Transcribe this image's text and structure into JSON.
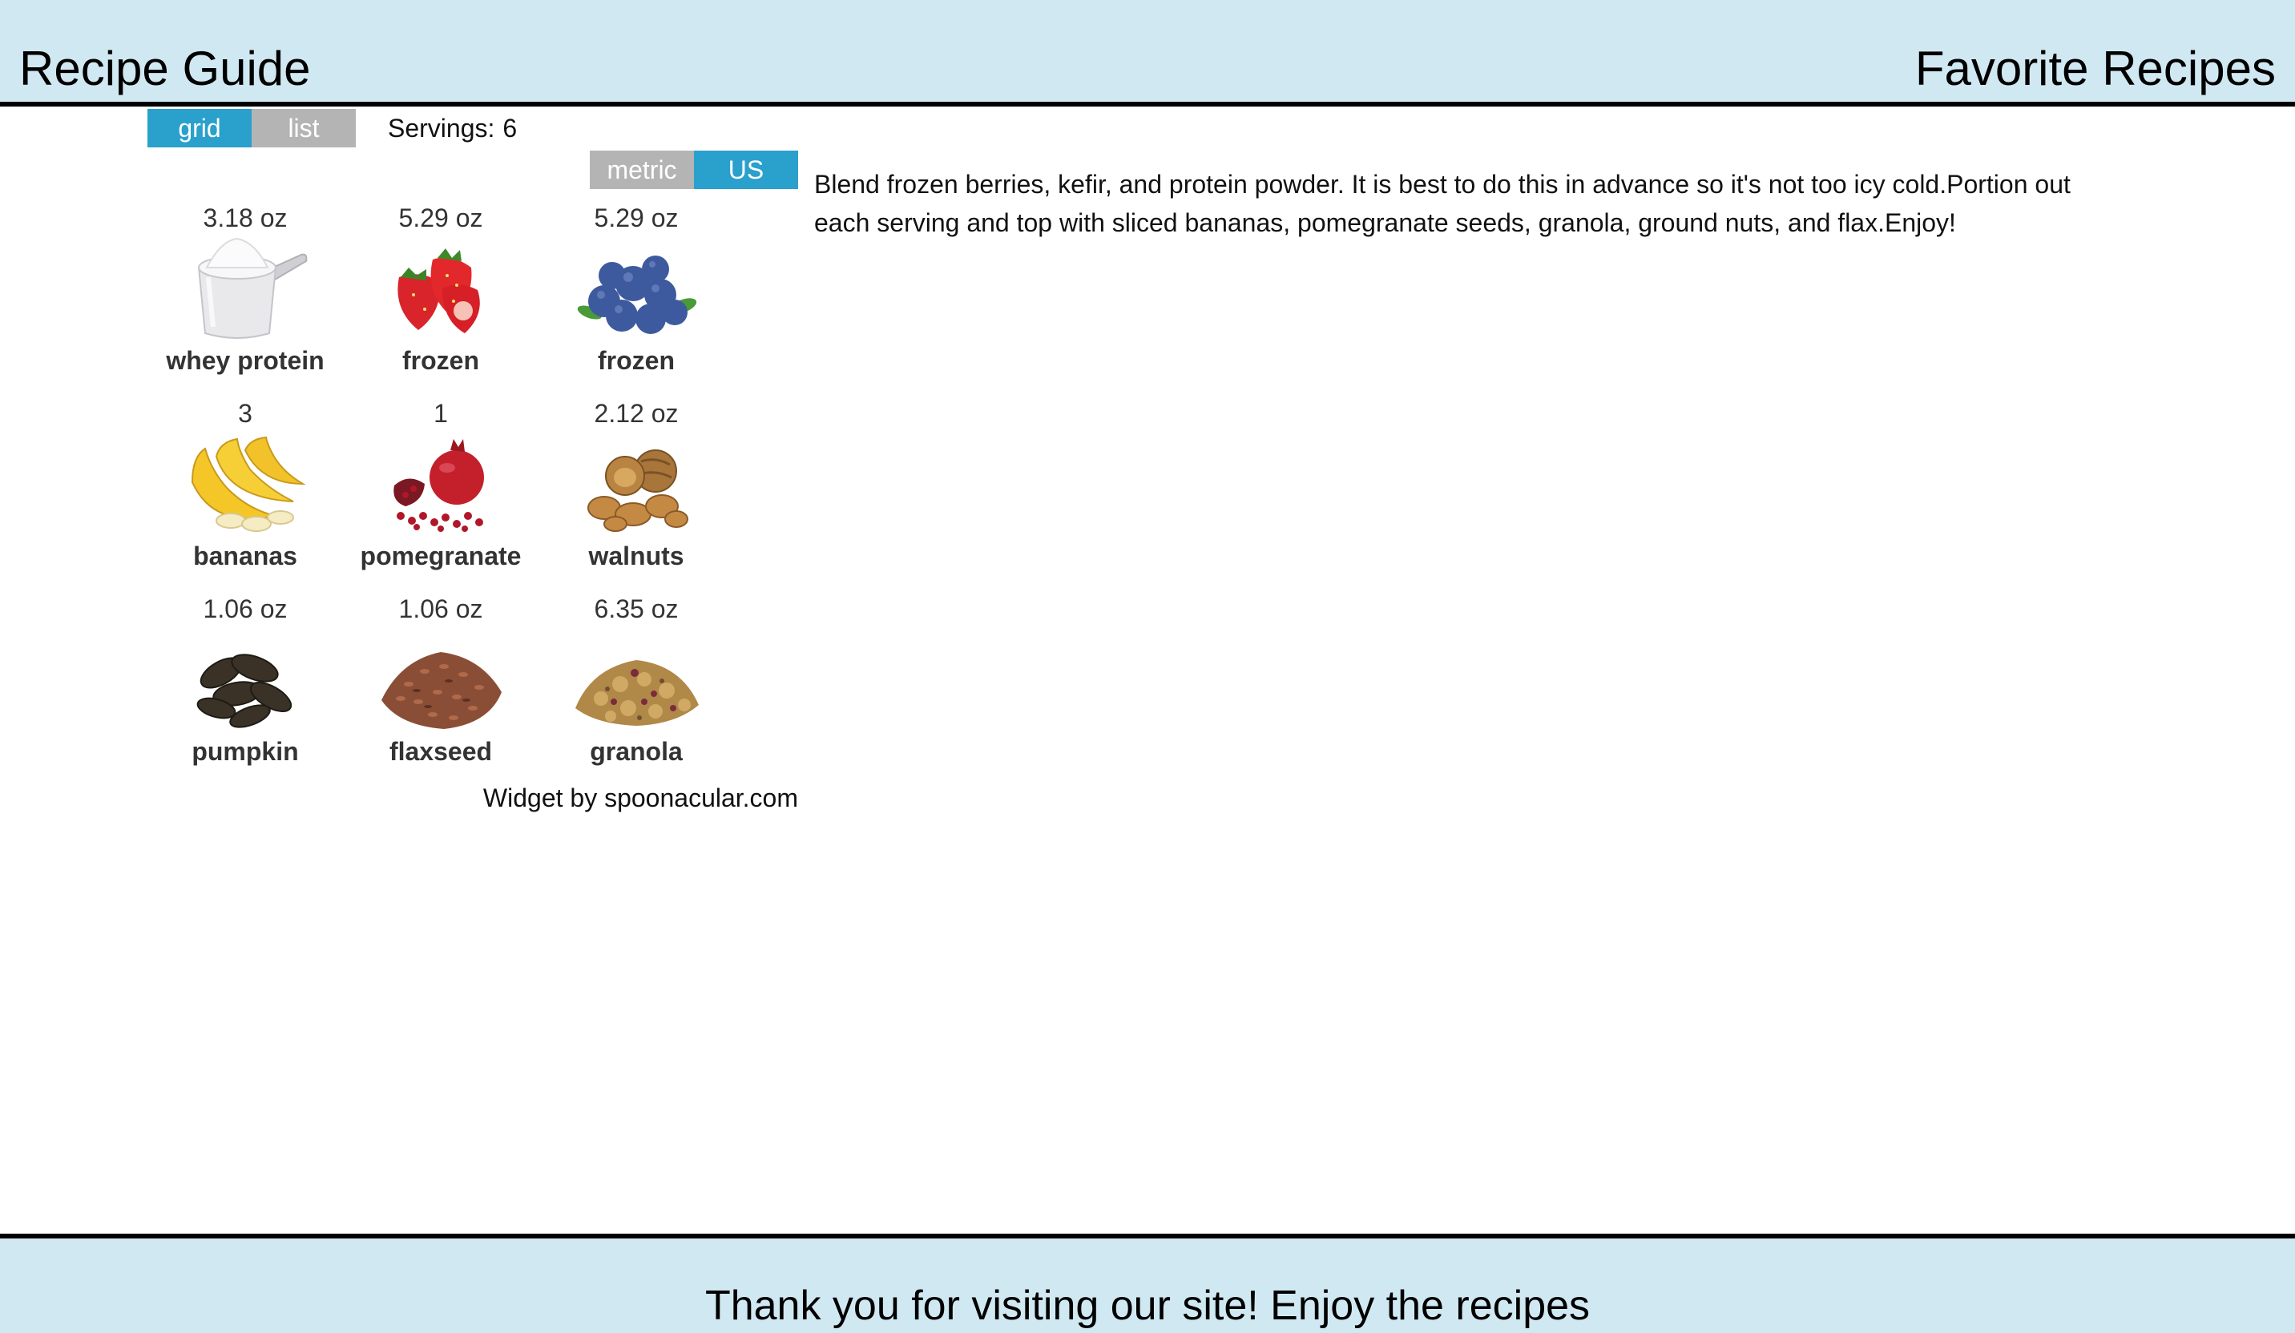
{
  "header": {
    "title": "Recipe Guide",
    "right_title": "Favorite Recipes"
  },
  "widget": {
    "view_toggle": {
      "grid_label": "grid",
      "list_label": "list",
      "active": "grid"
    },
    "servings": {
      "label": "Servings:",
      "value": "6"
    },
    "unit_toggle": {
      "metric_label": "metric",
      "us_label": "US",
      "active": "US"
    },
    "ingredients": [
      {
        "amount": "3.18 oz",
        "name": "whey protein",
        "icon": "protein-powder-scoop-icon"
      },
      {
        "amount": "5.29 oz",
        "name": "frozen",
        "icon": "strawberries-icon"
      },
      {
        "amount": "5.29 oz",
        "name": "frozen",
        "icon": "blueberries-icon"
      },
      {
        "amount": "3",
        "name": "bananas",
        "icon": "bananas-icon"
      },
      {
        "amount": "1",
        "name": "pomegranate",
        "icon": "pomegranate-icon"
      },
      {
        "amount": "2.12 oz",
        "name": "walnuts",
        "icon": "walnuts-icon"
      },
      {
        "amount": "1.06 oz",
        "name": "pumpkin",
        "icon": "pumpkin-seeds-icon"
      },
      {
        "amount": "1.06 oz",
        "name": "flaxseed",
        "icon": "flaxseed-icon"
      },
      {
        "amount": "6.35 oz",
        "name": "granola",
        "icon": "granola-icon"
      }
    ],
    "credit": "Widget by spoonacular.com"
  },
  "instructions": "Blend frozen berries, kefir, and protein powder. It is best to do this in advance so it's not too icy cold.Portion out each serving and top with sliced bananas, pomegranate seeds, granola, ground nuts, and flax.Enjoy!",
  "footer": {
    "text": "Thank you for visiting our site! Enjoy the recipes"
  },
  "colors": {
    "header_bg": "#d0e8f2",
    "toggle_active": "#2aa0cc",
    "toggle_inactive": "#b4b4b4"
  }
}
